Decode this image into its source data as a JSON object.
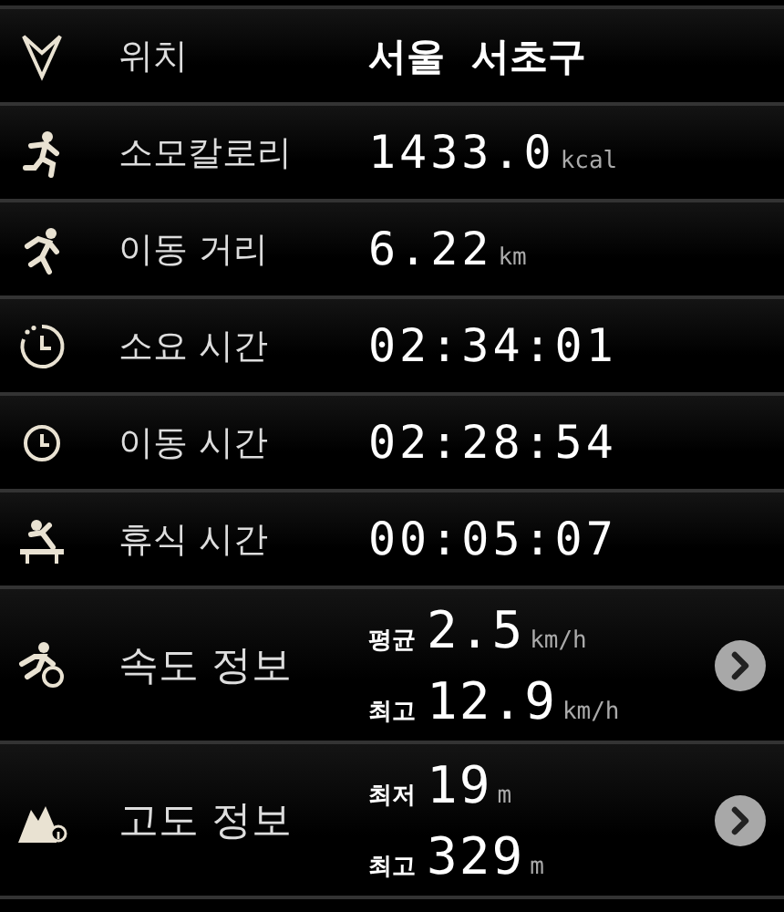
{
  "rows": [
    {
      "kind": "text",
      "label": "위치",
      "value": "서울  서초구"
    },
    {
      "kind": "number",
      "label": "소모칼로리",
      "value": "1433.0",
      "unit": "kcal"
    },
    {
      "kind": "number",
      "label": "이동 거리",
      "value": "6.22",
      "unit": "km"
    },
    {
      "kind": "number",
      "label": "소요 시간",
      "value": "02:34:01"
    },
    {
      "kind": "number",
      "label": "이동 시간",
      "value": "02:28:54"
    },
    {
      "kind": "number",
      "label": "휴식 시간",
      "value": "00:05:07"
    },
    {
      "kind": "detail",
      "label": "속도 정보",
      "lines": [
        {
          "label": "평균",
          "value": "2.5",
          "unit": "km/h"
        },
        {
          "label": "최고",
          "value": "12.9",
          "unit": "km/h"
        }
      ]
    },
    {
      "kind": "detail",
      "label": "고도 정보",
      "lines": [
        {
          "label": "최저",
          "value": "19",
          "unit": "m"
        },
        {
          "label": "최고",
          "value": "329",
          "unit": "m"
        }
      ]
    }
  ]
}
